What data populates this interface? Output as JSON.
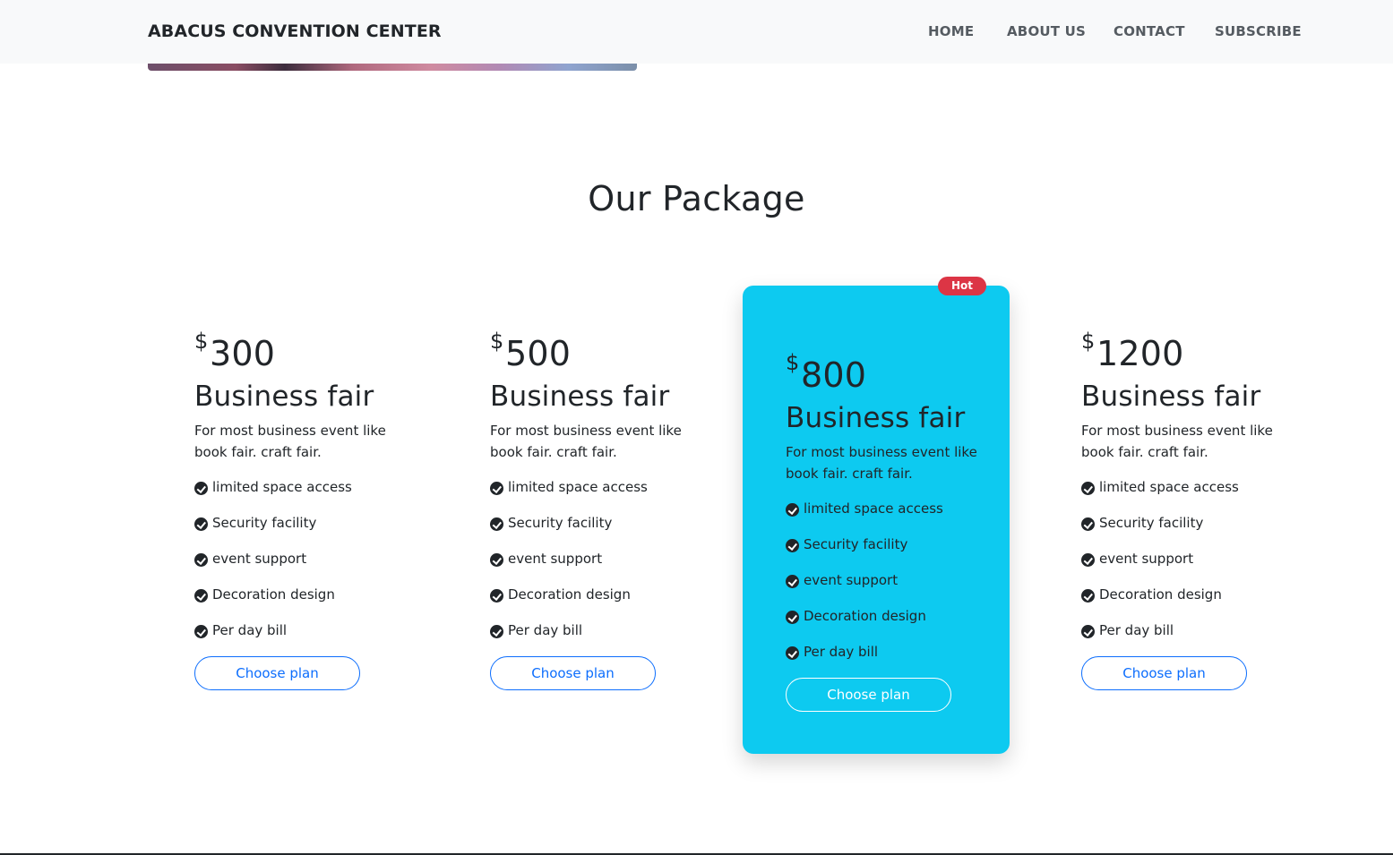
{
  "navbar": {
    "brand": "ABACUS CONVENTION CENTER",
    "links": [
      "HOME",
      "ABOUT US",
      "CONTACT",
      "SUBSCRIBE"
    ]
  },
  "section": {
    "title": "Our Package"
  },
  "packages": [
    {
      "currency": "$",
      "price": "300",
      "name": "Business fair",
      "description": "For most business event like book fair. craft fair.",
      "features": [
        "limited space access",
        "Security facility",
        "event support",
        "Decoration design",
        "Per day bill"
      ],
      "button": "Choose plan"
    },
    {
      "currency": "$",
      "price": "500",
      "name": "Business fair",
      "description": "For most business event like book fair. craft fair.",
      "features": [
        "limited space access",
        "Security facility",
        "event support",
        "Decoration design",
        "Per day bill"
      ],
      "button": "Choose plan"
    },
    {
      "currency": "$",
      "price": "800",
      "name": "Business fair",
      "description": "For most business event like book fair. craft fair.",
      "features": [
        "limited space access",
        "Security facility",
        "event support",
        "Decoration design",
        "Per day bill"
      ],
      "button": "Choose plan",
      "badge": "Hot"
    },
    {
      "currency": "$",
      "price": "1200",
      "name": "Business fair",
      "description": "For most business event like book fair. craft fair.",
      "features": [
        "limited space access",
        "Security facility",
        "event support",
        "Decoration design",
        "Per day bill"
      ],
      "button": "Choose plan"
    }
  ],
  "colors": {
    "featured_card": "#0dcaf0",
    "badge": "#dc3545",
    "button_outline": "#0d6efd",
    "navbar_bg": "#f8f9fa",
    "text": "#212529"
  },
  "icons": {
    "feature_bullet": "check-circle-icon"
  }
}
